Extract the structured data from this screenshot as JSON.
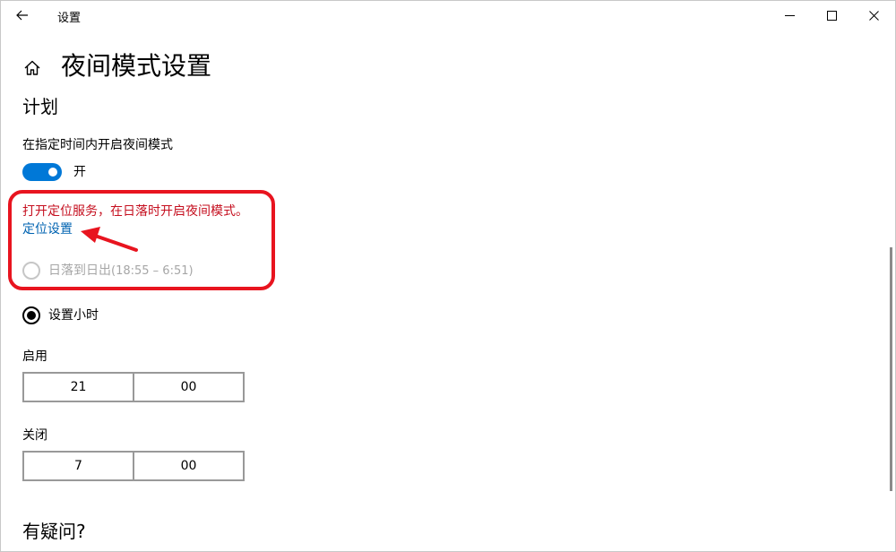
{
  "window": {
    "title": "设置",
    "back_icon": "back-arrow-icon",
    "controls": [
      "minimize-icon",
      "maximize-icon",
      "close-icon"
    ]
  },
  "header": {
    "home_icon": "home-icon",
    "title": "夜间模式设置"
  },
  "schedule": {
    "section_title": "计划",
    "toggle_label": "在指定时间内开启夜间模式",
    "toggle_state": "开",
    "location_warning": "打开定位服务，在日落时开启夜间模式。",
    "location_link": "定位设置",
    "sunset_option": "日落到日出",
    "sunset_time": "(18:55 – 6:51)",
    "hours_option": "设置小时",
    "turn_on_label": "启用",
    "turn_on_hour": "21",
    "turn_on_minute": "00",
    "turn_off_label": "关闭",
    "turn_off_hour": "7",
    "turn_off_minute": "00"
  },
  "help": {
    "title": "有疑问?"
  },
  "colors": {
    "accent": "#0078d7",
    "link": "#0063b1",
    "warning_text": "#c50f1f",
    "annotation": "#e8141f"
  }
}
